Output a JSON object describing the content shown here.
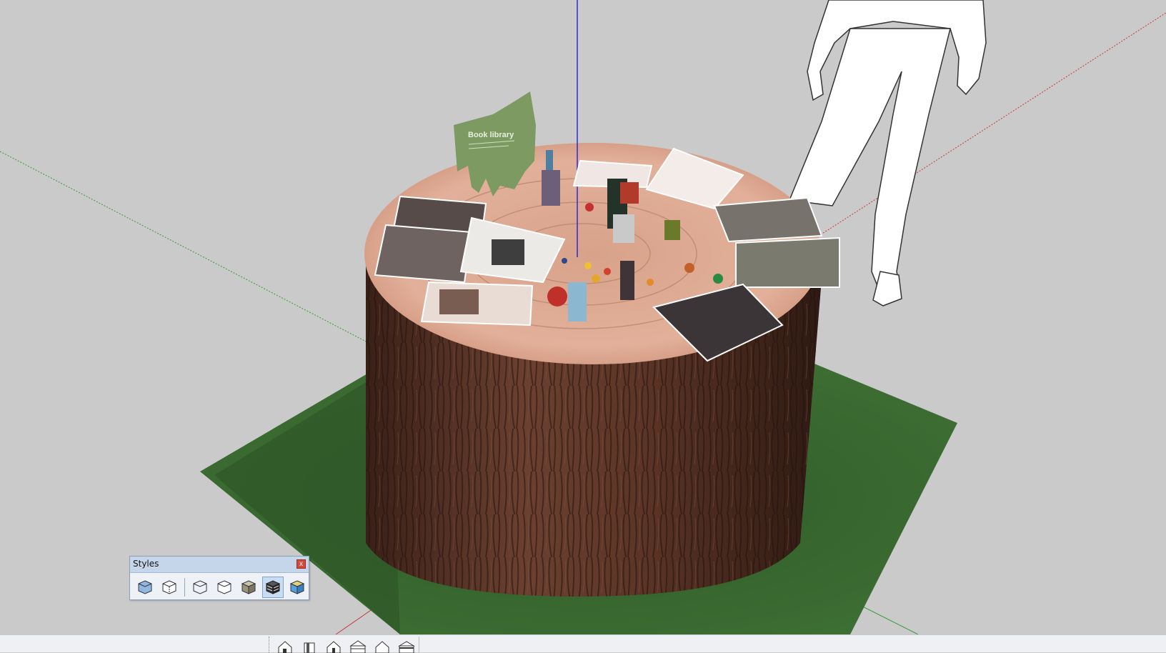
{
  "styles_panel": {
    "title": "Styles",
    "close_label": "x",
    "buttons": [
      {
        "icon": "xray-icon",
        "active": false
      },
      {
        "icon": "back-edges-icon",
        "active": false
      },
      {
        "icon": "wireframe-icon",
        "active": false
      },
      {
        "icon": "hidden-line-icon",
        "active": false
      },
      {
        "icon": "shaded-icon",
        "active": false
      },
      {
        "icon": "shaded-with-textures-icon",
        "active": true
      },
      {
        "icon": "monochrome-icon",
        "active": false
      }
    ]
  },
  "bottom_toolbar": {
    "views": [
      "iso-view-icon",
      "top-view-icon",
      "front-view-icon",
      "right-view-icon",
      "back-view-icon",
      "left-view-icon"
    ]
  },
  "scene": {
    "sign_text": "Book library",
    "colors": {
      "background": "#cacaca",
      "axis_blue": "#2a2ad6",
      "axis_red": "#c83a3a",
      "axis_green": "#3a9a3a",
      "grass": "#355f2c",
      "bark": "#5a3525",
      "stump_top": "#d9a48e"
    }
  }
}
